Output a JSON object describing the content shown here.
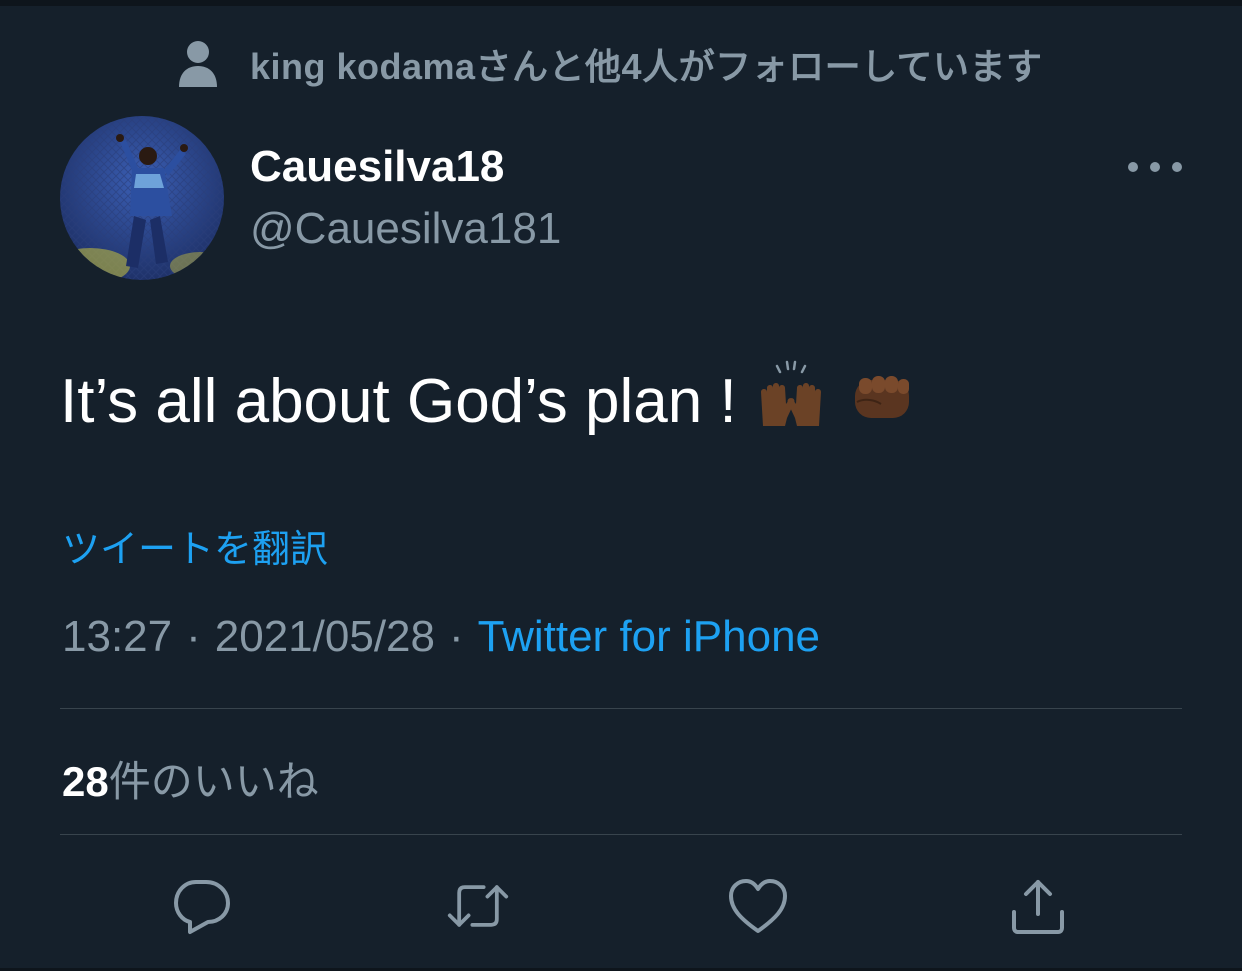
{
  "social_context": {
    "icon": "person-icon",
    "text": "king kodamaさんと他4人がフォローしています"
  },
  "author": {
    "avatar": "avatar",
    "display_name": "Cauesilva18",
    "handle": "@Cauesilva181"
  },
  "more_icon": "more-dots-icon",
  "tweet": {
    "text": "It’s all about God’s plan !",
    "emojis": [
      "raising-hands-emoji",
      "fist-bump-emoji"
    ]
  },
  "translate_label": "ツイートを翻訳",
  "meta": {
    "time": "13:27",
    "separator": "·",
    "date": "2021/05/28",
    "source": "Twitter for iPhone"
  },
  "likes": {
    "count": "28",
    "label": "件のいいね"
  },
  "actions": [
    {
      "name": "reply-icon"
    },
    {
      "name": "retweet-icon"
    },
    {
      "name": "like-icon"
    },
    {
      "name": "share-icon"
    }
  ],
  "colors": {
    "background": "#15202b",
    "secondary_text": "#8899a6",
    "link": "#1da1f2",
    "divider": "#38444d"
  }
}
